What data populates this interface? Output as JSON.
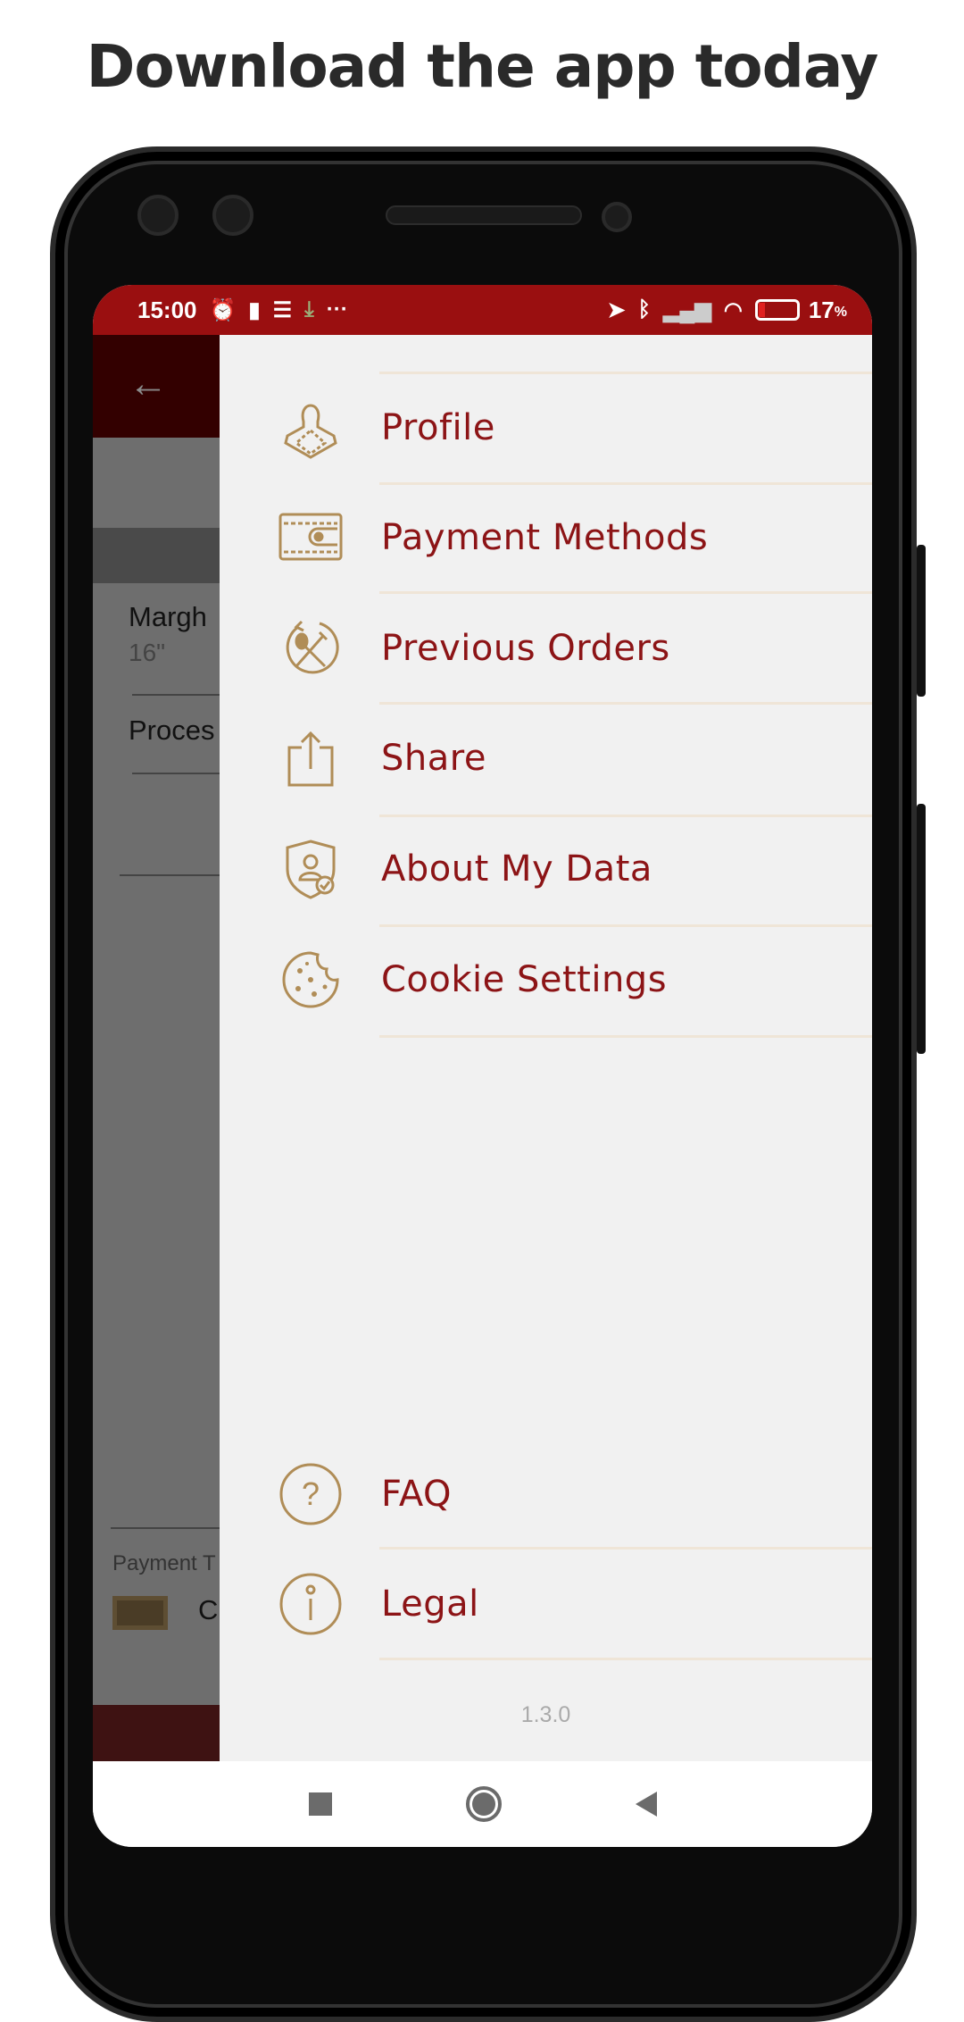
{
  "headline": "Download the app today",
  "status_bar": {
    "time": "15:00",
    "battery": "17",
    "battery_unit": "%",
    "icons": [
      "alarm-icon",
      "battery-saver-icon",
      "notification-icon",
      "download-icon",
      "more-icon",
      "location-icon",
      "bluetooth-icon",
      "signal-roaming-icon",
      "wifi-icon",
      "battery-icon"
    ]
  },
  "background_screen": {
    "item_name": "Margh",
    "item_size": "16\"",
    "status": "Proces",
    "payment_label": "Payment T",
    "payment_value": "C"
  },
  "drawer": {
    "items": [
      {
        "label": "Profile",
        "icon": "profile-icon"
      },
      {
        "label": "Payment Methods",
        "icon": "wallet-icon"
      },
      {
        "label": "Previous Orders",
        "icon": "reorder-icon"
      },
      {
        "label": "Share",
        "icon": "share-icon"
      },
      {
        "label": "About My Data",
        "icon": "data-shield-icon"
      },
      {
        "label": "Cookie Settings",
        "icon": "cookie-icon"
      }
    ],
    "bottom_items": [
      {
        "label": "FAQ",
        "icon": "question-icon"
      },
      {
        "label": "Legal",
        "icon": "info-icon"
      }
    ],
    "version": "1.3.0"
  },
  "colors": {
    "accent": "#8c1416",
    "icon_gold": "#b08d57",
    "status_bar": "#9a0f10"
  }
}
